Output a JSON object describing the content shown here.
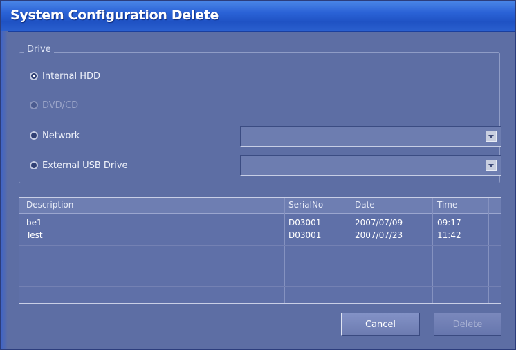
{
  "window": {
    "title": "System Configuration Delete"
  },
  "drive": {
    "legend": "Drive",
    "options": [
      {
        "label": "Internal HDD",
        "checked": true,
        "enabled": true
      },
      {
        "label": "DVD/CD",
        "checked": false,
        "enabled": false
      },
      {
        "label": "Network",
        "checked": false,
        "enabled": true
      },
      {
        "label": "External USB Drive",
        "checked": false,
        "enabled": true
      }
    ],
    "network_select": {
      "value": ""
    },
    "usb_select": {
      "value": ""
    }
  },
  "table": {
    "columns": [
      "Description",
      "SerialNo",
      "Date",
      "Time"
    ],
    "rows": [
      {
        "description": "be1",
        "serialno": "D03001",
        "date": "2007/07/09",
        "time": "09:17"
      },
      {
        "description": "Test",
        "serialno": "D03001",
        "date": "2007/07/23",
        "time": "11:42"
      }
    ]
  },
  "buttons": {
    "cancel": "Cancel",
    "delete": "Delete"
  },
  "colors": {
    "titlebar": "#2a62d6",
    "window": "#5d6ea4"
  }
}
